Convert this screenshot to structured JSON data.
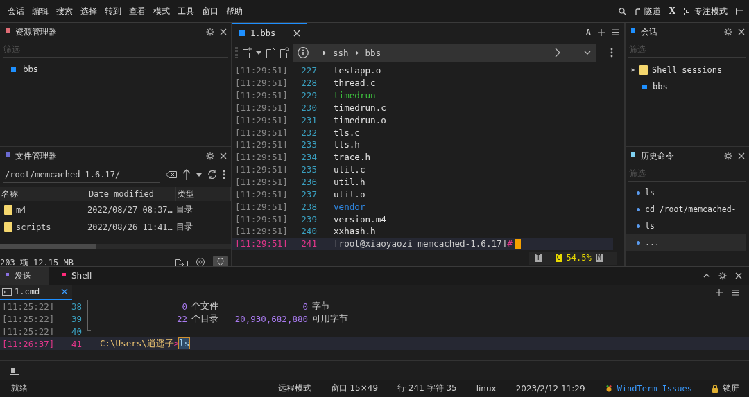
{
  "menu": {
    "items": [
      "会话",
      "编辑",
      "搜索",
      "选择",
      "转到",
      "查看",
      "模式",
      "工具",
      "窗口",
      "帮助"
    ],
    "tools": [
      {
        "kind": "search"
      },
      {
        "kind": "tunnel",
        "label": "隧道"
      },
      {
        "kind": "x",
        "label": "X"
      },
      {
        "kind": "focus",
        "label": "专注模式"
      },
      {
        "kind": "layout"
      }
    ]
  },
  "explorer": {
    "title": "资源管理器",
    "filter_placeholder": "筛选",
    "items": [
      {
        "label": "bbs"
      }
    ]
  },
  "file_manager": {
    "title": "文件管理器",
    "path": "/root/memcached-1.6.17/",
    "columns": [
      "名称",
      "Date modified",
      "类型"
    ],
    "rows": [
      {
        "name": "m4",
        "date": "2022/08/27 08:37…",
        "type": "目录"
      },
      {
        "name": "scripts",
        "date": "2022/08/26 11:41…",
        "type": "目录"
      }
    ],
    "summary": "203 项 12.15 MB"
  },
  "terminal": {
    "tab": {
      "label": "1.bbs",
      "selected": true
    },
    "font_button": "A",
    "breadcrumb": [
      "ssh",
      "bbs"
    ],
    "lines": [
      {
        "time": "[11:29:51]",
        "num": "227",
        "kind": "file",
        "text": "testapp.o"
      },
      {
        "time": "[11:29:51]",
        "num": "228",
        "kind": "file",
        "text": "thread.c"
      },
      {
        "time": "[11:29:51]",
        "num": "229",
        "kind": "exec",
        "text": "timedrun"
      },
      {
        "time": "[11:29:51]",
        "num": "230",
        "kind": "file",
        "text": "timedrun.c"
      },
      {
        "time": "[11:29:51]",
        "num": "231",
        "kind": "file",
        "text": "timedrun.o"
      },
      {
        "time": "[11:29:51]",
        "num": "232",
        "kind": "file",
        "text": "tls.c"
      },
      {
        "time": "[11:29:51]",
        "num": "233",
        "kind": "file",
        "text": "tls.h"
      },
      {
        "time": "[11:29:51]",
        "num": "234",
        "kind": "file",
        "text": "trace.h"
      },
      {
        "time": "[11:29:51]",
        "num": "235",
        "kind": "file",
        "text": "util.c"
      },
      {
        "time": "[11:29:51]",
        "num": "236",
        "kind": "file",
        "text": "util.h"
      },
      {
        "time": "[11:29:51]",
        "num": "237",
        "kind": "file",
        "text": "util.o"
      },
      {
        "time": "[11:29:51]",
        "num": "238",
        "kind": "dir",
        "text": "vendor"
      },
      {
        "time": "[11:29:51]",
        "num": "239",
        "kind": "file",
        "text": "version.m4"
      },
      {
        "time": "[11:29:51]",
        "num": "240",
        "kind": "file",
        "text": "xxhash.h"
      },
      {
        "time": "[11:29:51]",
        "num": "241",
        "kind": "prompt",
        "text": "[root@xiaoyaozi memcached-1.6.17]",
        "symbol": "#"
      }
    ],
    "status": [
      {
        "kind": "badge",
        "text": "T"
      },
      {
        "kind": "text",
        "text": "-"
      },
      {
        "kind": "active-badge",
        "text": "C"
      },
      {
        "kind": "value",
        "text": "54.5%"
      },
      {
        "kind": "badge",
        "text": "M"
      },
      {
        "kind": "text",
        "text": "-"
      }
    ]
  },
  "sessions": {
    "title": "会话",
    "filter_placeholder": "筛选",
    "tree": [
      {
        "kind": "folder",
        "label": "Shell sessions",
        "expanded": false
      },
      {
        "kind": "session",
        "label": "bbs"
      }
    ]
  },
  "history": {
    "title": "历史命令",
    "filter_placeholder": "筛选",
    "items": [
      {
        "text": "ls",
        "selected": false
      },
      {
        "text": "cd /root/memcached-",
        "selected": false
      },
      {
        "text": "ls",
        "selected": false
      },
      {
        "text": "...",
        "selected": true
      }
    ]
  },
  "bottom": {
    "tabs": [
      {
        "label": "发送",
        "selected": false
      },
      {
        "label": "Shell",
        "selected": true
      }
    ],
    "session_tab": {
      "label": "1.cmd",
      "selected": true
    },
    "lines": [
      {
        "time": "[11:25:22]",
        "num": "38",
        "kind": "count",
        "count": "0",
        "label": "个文件",
        "size": "0",
        "unit": "字节"
      },
      {
        "time": "[11:25:22]",
        "num": "39",
        "kind": "count",
        "count": "22",
        "label": "个目录",
        "size": "20,930,682,880",
        "unit": "可用字节"
      },
      {
        "time": "[11:25:22]",
        "num": "40",
        "kind": "empty"
      },
      {
        "time": "[11:26:37]",
        "num": "41",
        "kind": "prompt",
        "path": "C:\\Users\\逍遥子",
        "symbol": ">",
        "command": "ls"
      }
    ]
  },
  "status_bar": {
    "left": "就绪",
    "items": [
      {
        "kind": "text",
        "text": "远程模式"
      },
      {
        "kind": "text",
        "text": "窗口 15×49"
      },
      {
        "kind": "text",
        "text": "行 241 字符 35"
      },
      {
        "kind": "text",
        "text": "linux"
      },
      {
        "kind": "text",
        "text": "2023/2/12 11:29"
      },
      {
        "kind": "link",
        "text": "WindTerm Issues"
      },
      {
        "kind": "lock",
        "text": "锁屏"
      }
    ]
  }
}
